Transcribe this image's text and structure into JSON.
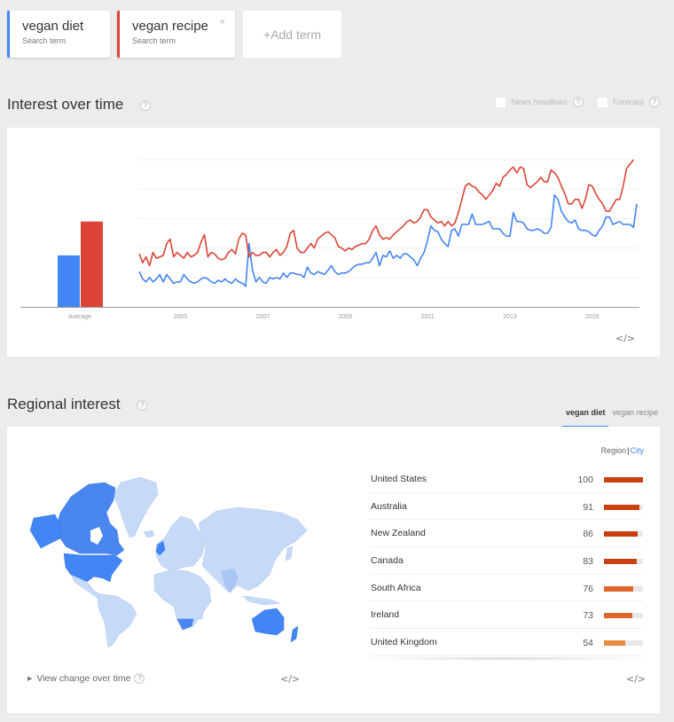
{
  "terms": [
    {
      "name": "vegan diet",
      "subtitle": "Search term",
      "color": "#4285f4",
      "removable": false
    },
    {
      "name": "vegan recipe",
      "subtitle": "Search term",
      "color": "#db4437",
      "removable": true
    }
  ],
  "close_icon": "×",
  "add_term_label": "+Add term",
  "interest_over_time": {
    "title": "Interest over time",
    "help": "?",
    "options": [
      {
        "label": "News headlines",
        "checked": false,
        "help": "?"
      },
      {
        "label": "Forecast",
        "checked": false,
        "help": "?"
      }
    ],
    "embed_icon": "</>"
  },
  "chart_data": {
    "type": "line",
    "title": "Interest over time",
    "xlabel": "",
    "ylabel": "",
    "ylim": [
      0,
      100
    ],
    "grid": true,
    "x_start": "2004-01",
    "x_step": "month",
    "x_ticks": [
      "2005",
      "2007",
      "2009",
      "2011",
      "2013",
      "2015"
    ],
    "average": {
      "label": "Average",
      "values": [
        {
          "name": "vegan diet",
          "value": 35,
          "color": "#4285f4"
        },
        {
          "name": "vegan recipe",
          "value": 58,
          "color": "#db4437"
        }
      ]
    },
    "series": [
      {
        "name": "vegan recipe",
        "color": "#db4437",
        "values": [
          36,
          30,
          34,
          28,
          37,
          33,
          34,
          35,
          43,
          46,
          34,
          37,
          35,
          33,
          37,
          34,
          35,
          37,
          44,
          49,
          34,
          37,
          36,
          33,
          32,
          33,
          37,
          39,
          36,
          46,
          50,
          49,
          34,
          37,
          35,
          35,
          37,
          37,
          34,
          37,
          39,
          35,
          37,
          41,
          50,
          52,
          40,
          37,
          37,
          40,
          43,
          40,
          46,
          48,
          50,
          51,
          49,
          47,
          41,
          40,
          38,
          40,
          39,
          41,
          42,
          43,
          43,
          46,
          52,
          55,
          49,
          46,
          47,
          46,
          49,
          51,
          53,
          55,
          58,
          59,
          57,
          58,
          61,
          66,
          66,
          61,
          59,
          57,
          58,
          55,
          58,
          55,
          57,
          64,
          73,
          82,
          84,
          82,
          81,
          78,
          76,
          73,
          76,
          79,
          84,
          82,
          88,
          90,
          93,
          95,
          91,
          95,
          94,
          83,
          81,
          83,
          85,
          88,
          85,
          85,
          93,
          91,
          88,
          82,
          77,
          70,
          70,
          73,
          73,
          67,
          73,
          83,
          82,
          77,
          73,
          70,
          65,
          65,
          69,
          73,
          73,
          82,
          94,
          97,
          100
        ],
        "values_note": "monthly, Jan 2004 onward (approximate, read from plot)"
      },
      {
        "name": "vegan diet",
        "color": "#4285f4",
        "values": [
          24,
          19,
          17,
          20,
          17,
          19,
          22,
          17,
          22,
          19,
          16,
          17,
          17,
          22,
          19,
          17,
          16,
          17,
          19,
          20,
          19,
          17,
          16,
          18,
          17,
          19,
          17,
          16,
          19,
          17,
          16,
          14,
          43,
          25,
          17,
          20,
          17,
          16,
          20,
          19,
          20,
          19,
          23,
          20,
          23,
          23,
          22,
          22,
          20,
          27,
          23,
          22,
          24,
          23,
          22,
          25,
          28,
          24,
          22,
          23,
          23,
          24,
          26,
          28,
          29,
          29,
          30,
          30,
          33,
          37,
          28,
          35,
          34,
          38,
          33,
          35,
          33,
          36,
          36,
          34,
          32,
          28,
          33,
          37,
          45,
          55,
          52,
          51,
          46,
          43,
          41,
          52,
          53,
          48,
          56,
          56,
          56,
          63,
          56,
          56,
          56,
          57,
          58,
          53,
          53,
          53,
          50,
          48,
          48,
          64,
          58,
          58,
          57,
          53,
          52,
          52,
          53,
          52,
          50,
          50,
          54,
          76,
          73,
          65,
          61,
          58,
          57,
          59,
          53,
          52,
          52,
          51,
          49,
          48,
          52,
          55,
          61,
          61,
          56,
          57,
          58,
          56,
          56,
          56,
          54,
          70
        ],
        "values_note": "monthly, Jan 2004 onward (approximate, read from plot)"
      }
    ]
  },
  "regional_interest": {
    "title": "Regional interest",
    "help": "?",
    "tabs": [
      {
        "label": "vegan diet",
        "active": true
      },
      {
        "label": "vegan recipe",
        "active": false
      }
    ],
    "toggle": {
      "region": "Region",
      "separator": "|",
      "city": "City"
    },
    "rows": [
      {
        "name": "United States",
        "value": 100,
        "color": "#cc4010"
      },
      {
        "name": "Australia",
        "value": 91,
        "color": "#cc4010"
      },
      {
        "name": "New Zealand",
        "value": 86,
        "color": "#cc4010"
      },
      {
        "name": "Canada",
        "value": 83,
        "color": "#cc4010"
      },
      {
        "name": "South Africa",
        "value": 76,
        "color": "#e0662a"
      },
      {
        "name": "Ireland",
        "value": 73,
        "color": "#e0662a"
      },
      {
        "name": "United Kingdom",
        "value": 54,
        "color": "#e98a3f"
      }
    ],
    "view_change_label": "View change over time",
    "view_change_icon": "▶",
    "embed_icon": "</>",
    "map_colors": {
      "high": "#4285f4",
      "mid": "#7baaf7",
      "low": "#c6d9f6"
    }
  }
}
